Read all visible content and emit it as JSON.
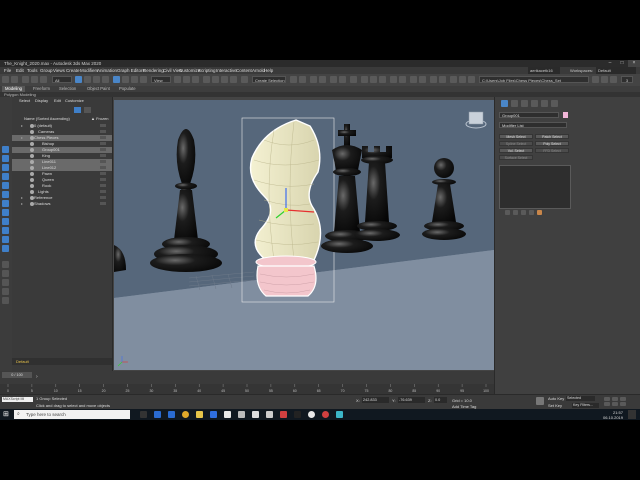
{
  "app": {
    "window_title": "The_Knight_2020.max - Autodesk 3ds Max 2020"
  },
  "menu": {
    "items": [
      "File",
      "Edit",
      "Tools",
      "Group",
      "Views",
      "Create",
      "Modifiers",
      "Animation",
      "Graph Editors",
      "Rendering",
      "Civil View",
      "Customize",
      "Scripting",
      "Interactive",
      "Content",
      "Arnold",
      "Help"
    ],
    "user": "aerikacetk16",
    "workspaces_label": "Workspaces:",
    "workspaces_value": "Default"
  },
  "toolbar": {
    "selection_filter": "All",
    "view_dropdown": "View",
    "selection_set": "Create Selection Se",
    "path": "C:\\Users\\Job Files\\Chess Pieces\\Chess_Set",
    "zoom_value": "3"
  },
  "ribbon": {
    "tabs": [
      "Modeling",
      "Freeform",
      "Selection",
      "Object Paint",
      "Populate"
    ],
    "active": "Modeling",
    "subtitle": "Polygon Modeling"
  },
  "explorer": {
    "tabs": [
      "Select",
      "Display",
      "Edit",
      "Customize"
    ],
    "column_header": "Name (Sorted Ascending)",
    "frozen_label": "▲ Frozen",
    "rows": [
      {
        "name": "0 (default)",
        "indent": 1,
        "selected": false
      },
      {
        "name": "Cameras",
        "indent": 2,
        "selected": false
      },
      {
        "name": "Chess Pieces",
        "indent": 1,
        "selected": true
      },
      {
        "name": "Bishop",
        "indent": 3,
        "selected": false
      },
      {
        "name": "Group001",
        "indent": 3,
        "selected": true
      },
      {
        "name": "King",
        "indent": 3,
        "selected": false
      },
      {
        "name": "Line011",
        "indent": 3,
        "selected": true
      },
      {
        "name": "Line012",
        "indent": 3,
        "selected": true
      },
      {
        "name": "Pawn",
        "indent": 3,
        "selected": false
      },
      {
        "name": "Queen",
        "indent": 3,
        "selected": false
      },
      {
        "name": "Rook",
        "indent": 3,
        "selected": false
      },
      {
        "name": "Lights",
        "indent": 2,
        "selected": false
      },
      {
        "name": "Reference",
        "indent": 1,
        "selected": false
      },
      {
        "name": "Shadows",
        "indent": 1,
        "selected": false
      }
    ],
    "layer_name": "Default"
  },
  "viewport": {
    "label": "[+] [Perspective] [User Defined] [Default Shading]",
    "stats": [
      "Total",
      "Polys: 11,320",
      "Verts: 5,766",
      "",
      "FPS:"
    ]
  },
  "command_panel": {
    "object_name": "Group001",
    "modifier_list": "Modifier List",
    "buttons": [
      {
        "label": "Mesh Select",
        "dim": false
      },
      {
        "label": "Patch Select",
        "dim": false
      },
      {
        "label": "Spline Select",
        "dim": true
      },
      {
        "label": "Poly Select",
        "dim": false
      },
      {
        "label": "Vol. Select",
        "dim": false
      },
      {
        "label": "FFD Select",
        "dim": true
      },
      {
        "label": "Surface Select",
        "dim": true
      }
    ]
  },
  "timeline": {
    "frame_counter": "0 / 100",
    "ticks": [
      "0",
      "5",
      "10",
      "15",
      "20",
      "25",
      "30",
      "35",
      "40",
      "45",
      "50",
      "55",
      "60",
      "65",
      "70",
      "75",
      "80",
      "85",
      "90",
      "95",
      "100"
    ]
  },
  "statusbar": {
    "maxscript": "MAXScript Mi",
    "message1": "1 Group Selected",
    "message2": "Click and drag to select and move objects",
    "x_label": "X:",
    "x_value": "242.833",
    "y_label": "Y:",
    "y_value": "-76.639",
    "z_label": "Z:",
    "z_value": "0.0",
    "grid": "Grid = 10.0",
    "add_time_tag": "Add Time Tag",
    "auto_key": "Auto Key",
    "selected_dropdown": "Selected",
    "set_key": "Set Key",
    "key_filters": "Key Filters..."
  },
  "taskbar": {
    "search_placeholder": "Type here to search",
    "time": "21:57",
    "date": "06.10.2019"
  },
  "colors": {
    "accent_blue": "#3f7fc8",
    "viewport_bg": "#7e8ea0",
    "wall_bg": "#4b5d72",
    "selection_white": "#ffffff"
  }
}
